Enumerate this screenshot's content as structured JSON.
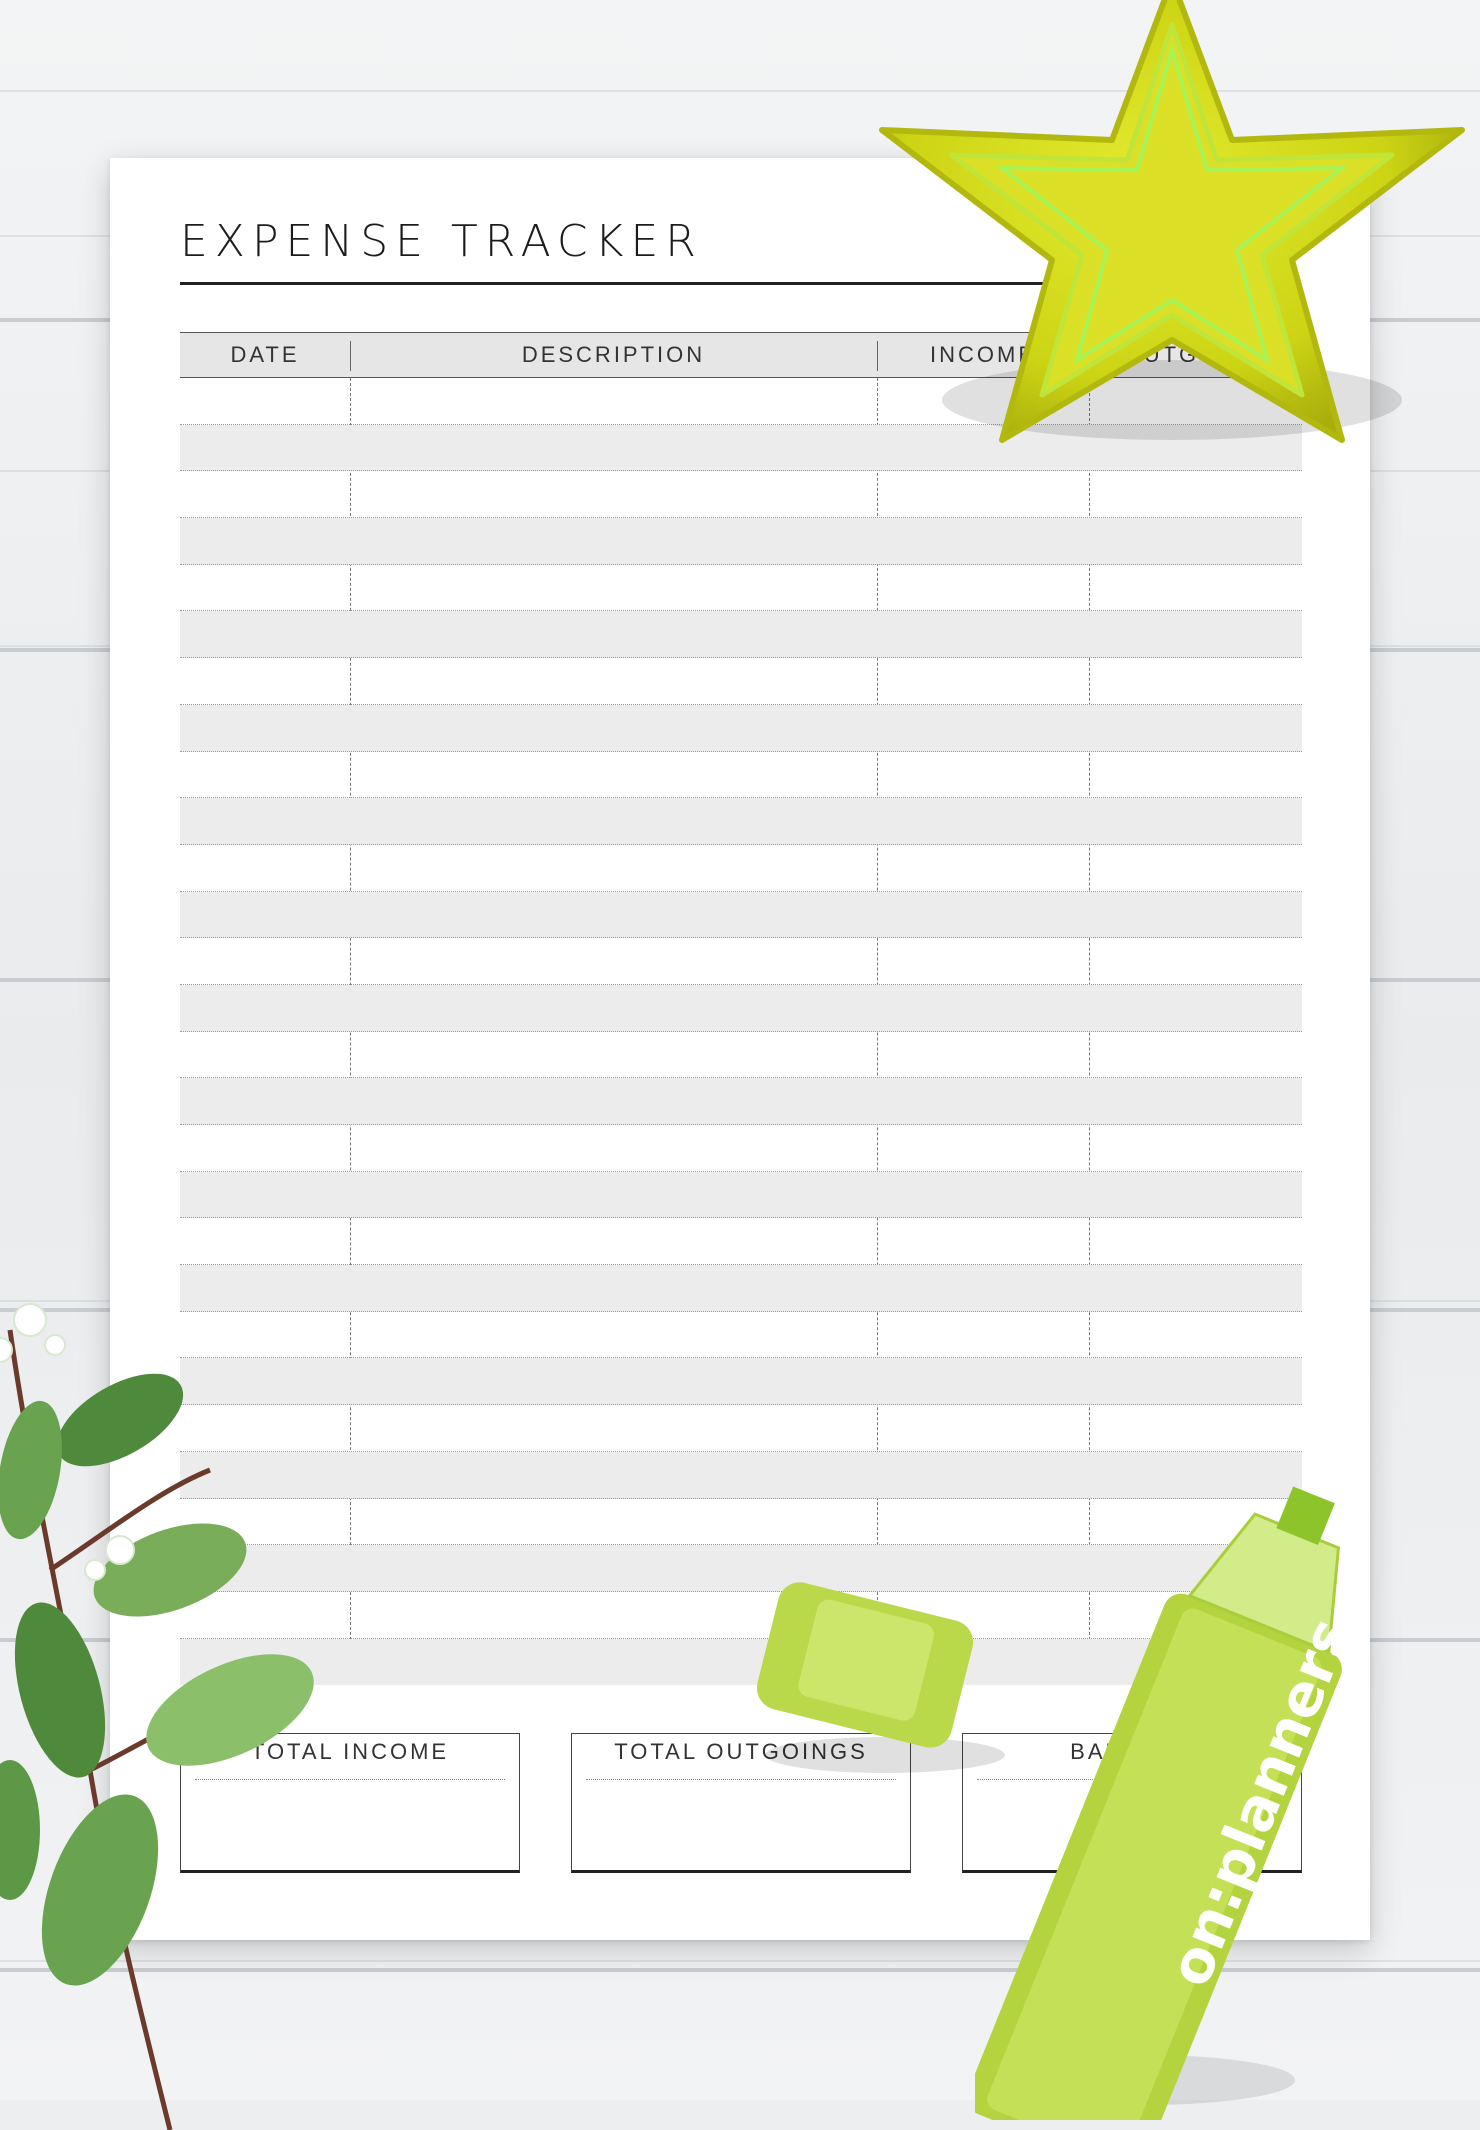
{
  "sheet": {
    "title": "EXPENSE TRACKER",
    "columns": [
      "DATE",
      "DESCRIPTION",
      "INCOME",
      "OUTGOING"
    ],
    "row_count": 28,
    "totals": [
      "TOTAL INCOME",
      "TOTAL OUTGOINGS",
      "BALANCE"
    ]
  },
  "brand": {
    "logo_text": "on:planners"
  },
  "colors": {
    "star": "#d6dc1a",
    "marker": "#b6d64a",
    "row_shade": "#ececec"
  }
}
